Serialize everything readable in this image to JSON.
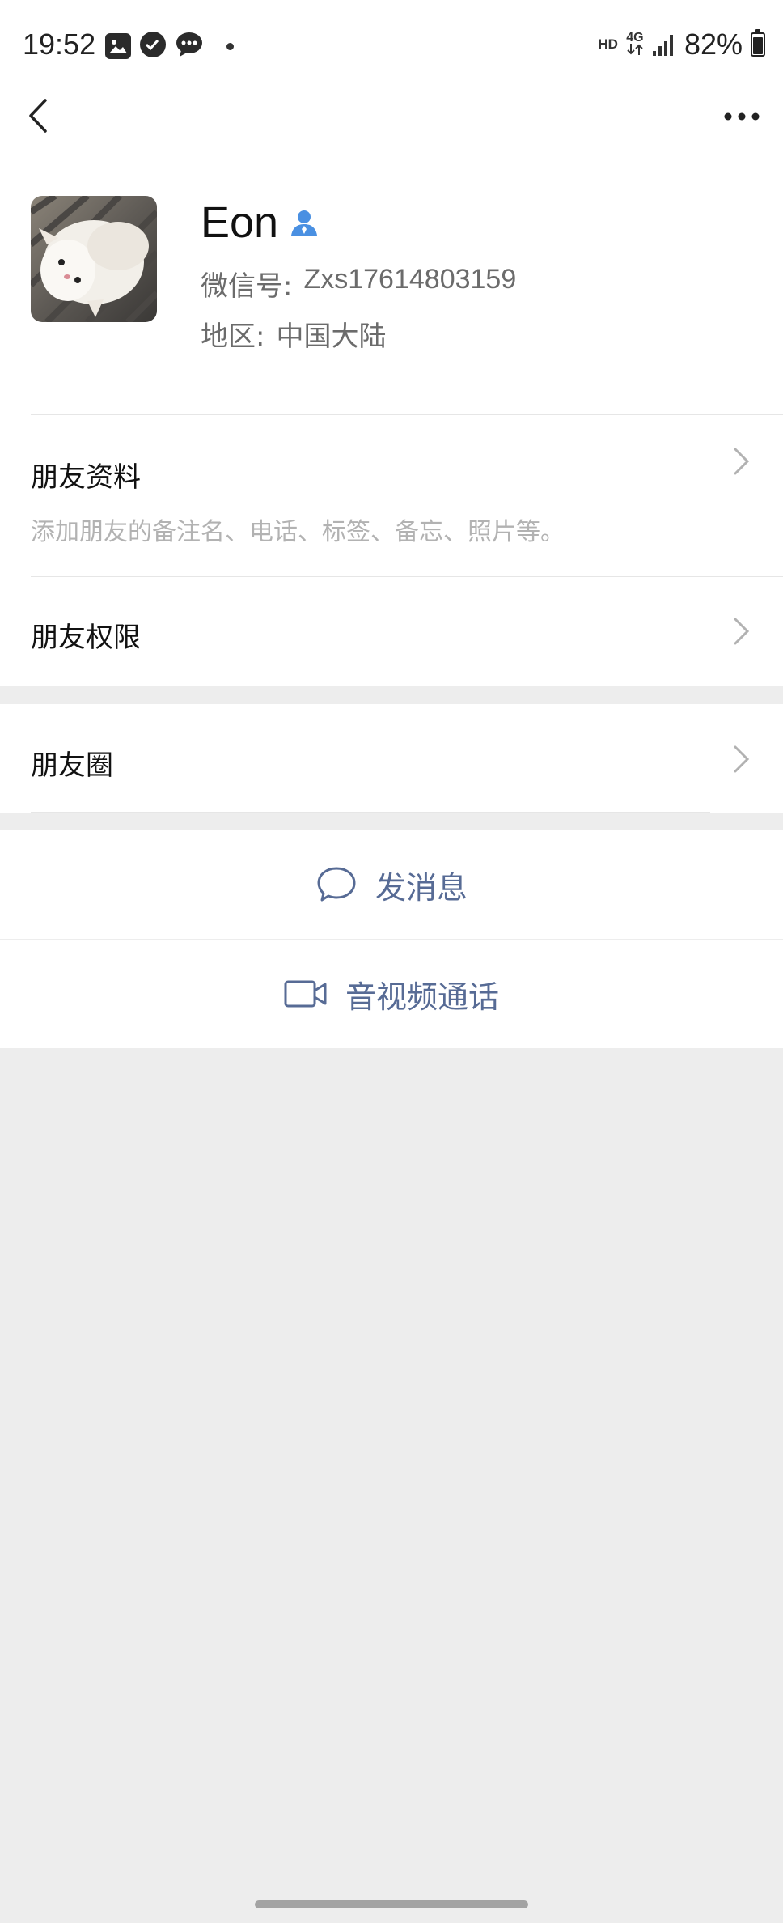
{
  "status_bar": {
    "time": "19:52",
    "hd": "HD",
    "network": "4G",
    "battery": "82%",
    "battery_level": 0.82,
    "icons": [
      "gallery-icon",
      "task-icon",
      "message-icon"
    ]
  },
  "nav": {
    "back_icon": "chevron-left-icon",
    "more_icon": "more-dots-icon"
  },
  "profile": {
    "name": "Eon",
    "wechat_id_label": "微信号:",
    "wechat_id": "Zxs17614803159",
    "region_label": "地区:",
    "region": "中国大陆"
  },
  "rows": {
    "friend_info": {
      "title": "朋友资料",
      "description": "添加朋友的备注名、电话、标签、备忘、照片等。"
    },
    "friend_permissions": {
      "title": "朋友权限"
    },
    "moments": {
      "title": "朋友圈"
    }
  },
  "actions": {
    "send_message": "发消息",
    "video_call": "音视频通话"
  },
  "colors": {
    "link_blue": "#576b95",
    "background": "#ededed",
    "contact_icon_blue": "#4a90e2"
  }
}
